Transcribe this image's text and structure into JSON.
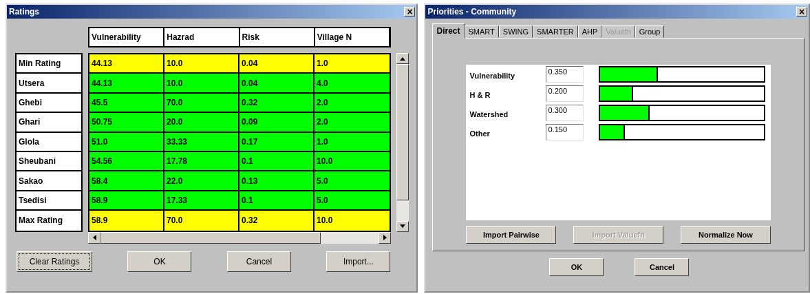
{
  "ratings_window": {
    "title": "Ratings",
    "close": "×",
    "columns": [
      "Vulnerability",
      "Hazrad",
      "Risk",
      "Village N"
    ],
    "rows": [
      {
        "label": "Min Rating",
        "color": "#ffff00",
        "cells": [
          "44.13",
          "10.0",
          "0.04",
          "1.0"
        ]
      },
      {
        "label": "Utsera",
        "color": "#00ff00",
        "cells": [
          "44.13",
          "10.0",
          "0.04",
          "4.0"
        ]
      },
      {
        "label": "Ghebi",
        "color": "#00ff00",
        "cells": [
          "45.5",
          "70.0",
          "0.32",
          "2.0"
        ]
      },
      {
        "label": "Ghari",
        "color": "#00ff00",
        "cells": [
          "50.75",
          "20.0",
          "0.09",
          "2.0"
        ]
      },
      {
        "label": "Glola",
        "color": "#00ff00",
        "cells": [
          "51.0",
          "33.33",
          "0.17",
          "1.0"
        ]
      },
      {
        "label": "Sheubani",
        "color": "#00ff00",
        "cells": [
          "54.56",
          "17.78",
          "0.1",
          "10.0"
        ]
      },
      {
        "label": "Sakao",
        "color": "#00ff00",
        "cells": [
          "58.4",
          "22.0",
          "0.13",
          "5.0"
        ]
      },
      {
        "label": "Tsedisi",
        "color": "#00ff00",
        "cells": [
          "58.9",
          "17.33",
          "0.1",
          "5.0"
        ]
      },
      {
        "label": "Max Rating",
        "color": "#ffff00",
        "cells": [
          "58.9",
          "70.0",
          "0.32",
          "10.0"
        ]
      }
    ],
    "buttons": [
      {
        "label": "Clear Ratings",
        "focused": true
      },
      {
        "label": "OK",
        "focused": false
      },
      {
        "label": "Cancel",
        "focused": false
      },
      {
        "label": "Import...",
        "focused": false
      }
    ]
  },
  "priorities_window": {
    "title": "Priorities - Community",
    "close": "×",
    "tabs": [
      {
        "label": "Direct",
        "selected": true,
        "disabled": false
      },
      {
        "label": "SMART",
        "selected": false,
        "disabled": false
      },
      {
        "label": "SWING",
        "selected": false,
        "disabled": false
      },
      {
        "label": "SMARTER",
        "selected": false,
        "disabled": false
      },
      {
        "label": "AHP",
        "selected": false,
        "disabled": false
      },
      {
        "label": "Valuefn",
        "selected": false,
        "disabled": true
      },
      {
        "label": "Group",
        "selected": false,
        "disabled": false
      }
    ],
    "criteria": [
      {
        "name": "Vulnerability",
        "value": "0.350",
        "level": 0.35
      },
      {
        "name": "H & R",
        "value": "0.200",
        "level": 0.2
      },
      {
        "name": "Watershed",
        "value": "0.300",
        "level": 0.3
      },
      {
        "name": "Other",
        "value": "0.150",
        "level": 0.15
      }
    ],
    "panel_buttons": [
      {
        "label": "Import Pairwise",
        "disabled": false
      },
      {
        "label": "Import Valuefn",
        "disabled": true
      },
      {
        "label": "Normalize Now",
        "disabled": false
      }
    ],
    "buttons": [
      "OK",
      "Cancel"
    ]
  }
}
